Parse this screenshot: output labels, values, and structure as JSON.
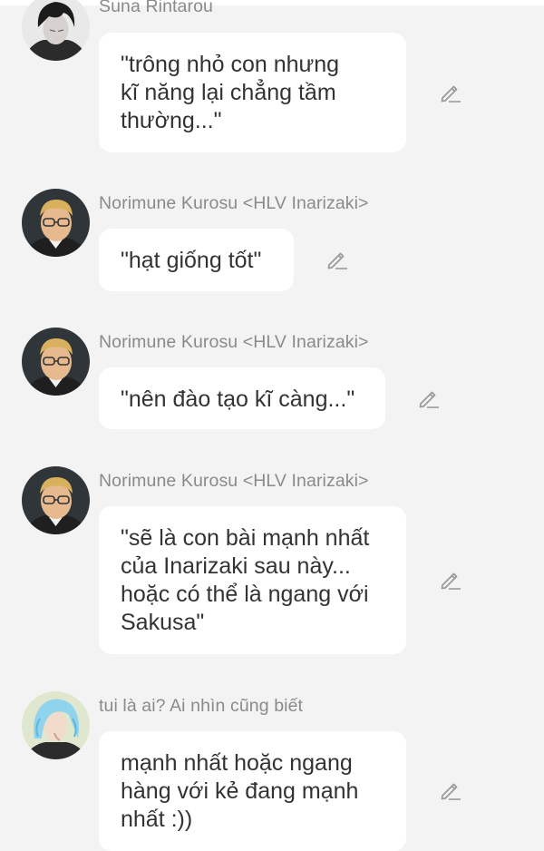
{
  "messages": [
    {
      "sender": "Suna Rintarou",
      "avatar": "suna-avatar",
      "text": "\"trông nhỏ con nhưng\nkĩ năng lại chẳng tầm\nthường...\""
    },
    {
      "sender": "Norimune Kurosu <HLV Inarizaki>",
      "avatar": "kurosu-avatar",
      "text": "\"hạt giống tốt\""
    },
    {
      "sender": "Norimune Kurosu <HLV Inarizaki>",
      "avatar": "kurosu-avatar",
      "text": "\"nên đào tạo kĩ càng...\""
    },
    {
      "sender": "Norimune Kurosu <HLV Inarizaki>",
      "avatar": "kurosu-avatar",
      "text": "\"sẽ là con bài mạnh nhất\ncủa Inarizaki sau này...\nhoặc có thể là ngang với\nSakusa\""
    },
    {
      "sender": "tui là ai? Ai nhìn cũng biết",
      "avatar": "user-avatar",
      "text": "mạnh nhất hoặc ngang\nhàng với kẻ đang mạnh\nnhất :))"
    }
  ],
  "icons": {
    "edit": "pencil-icon"
  },
  "colors": {
    "background": "#f3f3f3",
    "bubble": "#ffffff",
    "sender_text": "#8a8a8a",
    "message_text": "#333333",
    "icon": "#9a9a9a"
  }
}
